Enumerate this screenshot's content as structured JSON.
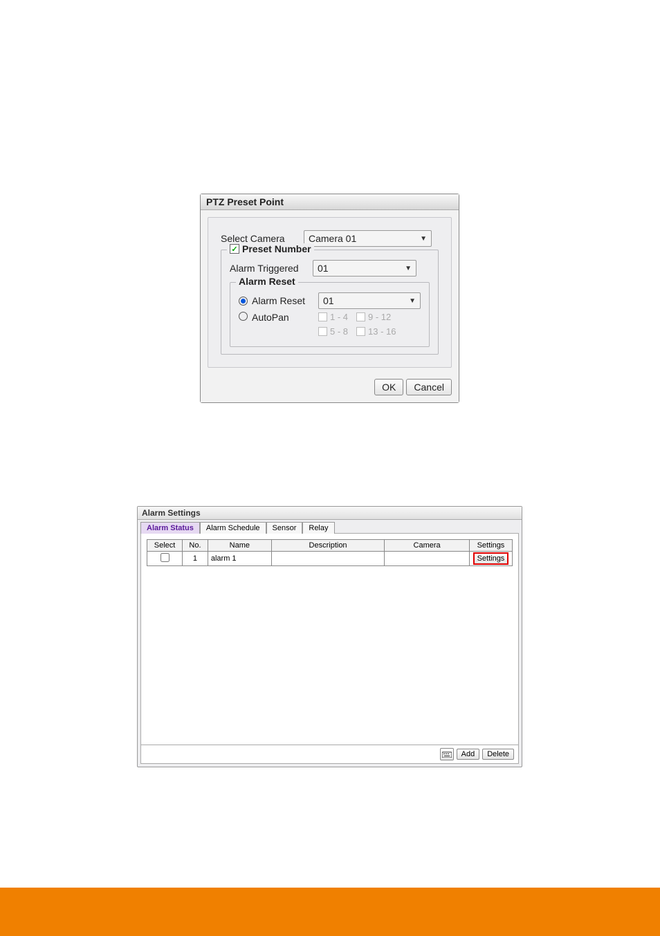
{
  "ptz": {
    "title": "PTZ Preset Point",
    "select_camera_label": "Select Camera",
    "select_camera_value": "Camera 01",
    "preset_number": {
      "legend": "Preset Number",
      "checked": true,
      "alarm_triggered_label": "Alarm Triggered",
      "alarm_triggered_value": "01",
      "alarm_reset": {
        "legend": "Alarm Reset",
        "radio_alarm_reset_label": "Alarm Reset",
        "radio_alarm_reset_value": "01",
        "radio_autopan_label": "AutoPan",
        "autopan_options": {
          "r1c1": "1 - 4",
          "r1c2": "9 - 12",
          "r2c1": "5 - 8",
          "r2c2": "13 - 16"
        }
      }
    },
    "buttons": {
      "ok": "OK",
      "cancel": "Cancel"
    }
  },
  "alarm": {
    "title": "Alarm Settings",
    "tabs": {
      "status": "Alarm Status",
      "schedule": "Alarm Schedule",
      "sensor": "Sensor",
      "relay": "Relay"
    },
    "columns": {
      "select": "Select",
      "no": "No.",
      "name": "Name",
      "description": "Description",
      "camera": "Camera",
      "settings": "Settings"
    },
    "row1": {
      "no": "1",
      "name": "alarm 1",
      "description": "",
      "camera": "",
      "settings_btn": "Settings"
    },
    "buttons": {
      "add": "Add",
      "delete": "Delete"
    }
  }
}
